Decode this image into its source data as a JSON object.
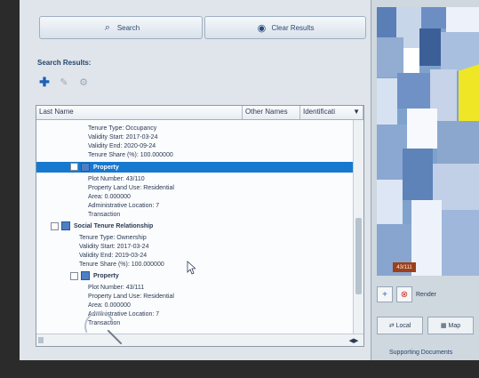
{
  "top_buttons": {
    "search": "Search",
    "clear_results": "Clear Results"
  },
  "search_results": {
    "title": "Search Results:"
  },
  "table": {
    "headers": [
      "Last Name",
      "Other Names",
      "Identificati"
    ],
    "rows": [
      {
        "text": "Tenure Type: Occupancy"
      },
      {
        "text": "Validity Start: 2017-03-24"
      },
      {
        "text": "Validity End: 2020-09-24"
      },
      {
        "text": "Tenure Share (%): 100.000000"
      },
      {
        "text": "Property",
        "selected": true
      },
      {
        "text": "Plot Number: 43/110"
      },
      {
        "text": "Property Land Use: Residential"
      },
      {
        "text": "Area: 0.000000"
      },
      {
        "text": "Administrative Location: 7"
      },
      {
        "text": "Transaction"
      },
      {
        "text": "Social Tenure Relationship",
        "bold": true
      },
      {
        "text": "Tenure Type: Ownership"
      },
      {
        "text": "Validity Start: 2017-03-24"
      },
      {
        "text": "Validity End: 2019-03-24"
      },
      {
        "text": "Tenure Share (%): 100.000000"
      },
      {
        "text": "Property",
        "bold": true
      },
      {
        "text": "Plot Number: 43/111"
      },
      {
        "text": "Property Land Use: Residential"
      },
      {
        "text": "Area: 0.000000"
      },
      {
        "text": "Administrative Location: 7"
      },
      {
        "text": "Transaction"
      }
    ]
  },
  "map": {
    "label": "43/111"
  },
  "right_controls": {
    "render": "Render",
    "local": "Local",
    "map": "Map"
  },
  "supporting_documents": "Supporting Documents",
  "icons": {
    "search": "search-icon",
    "clear": "clear-icon",
    "add": "plus-icon",
    "edit": "pencil-icon",
    "settings": "gear-icon"
  }
}
